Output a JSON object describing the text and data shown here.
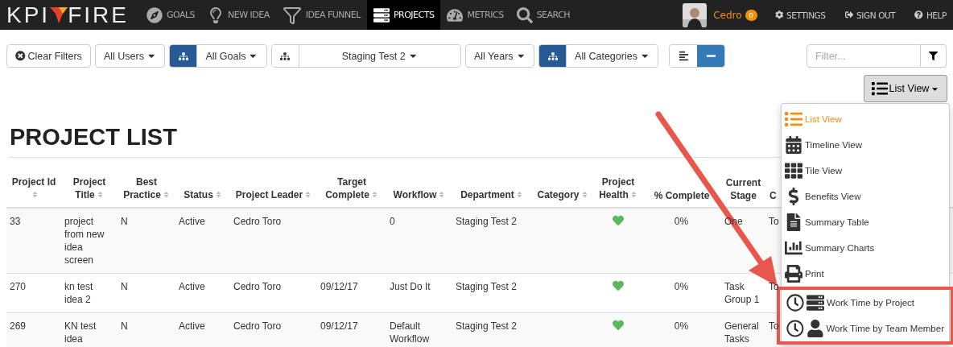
{
  "navbar": {
    "logo": {
      "left": "KPI",
      "right": "FIRE"
    },
    "items": [
      {
        "label": "GOALS",
        "selected": false
      },
      {
        "label": "NEW IDEA",
        "selected": false
      },
      {
        "label": "IDEA FUNNEL",
        "selected": false
      },
      {
        "label": "PROJECTS",
        "selected": true
      },
      {
        "label": "METRICS",
        "selected": false
      },
      {
        "label": "SEARCH",
        "selected": false
      }
    ],
    "user": {
      "name": "Cedro",
      "badge": "0"
    },
    "links": [
      {
        "label": "SETTINGS"
      },
      {
        "label": "SIGN OUT"
      },
      {
        "label": "HELP"
      }
    ]
  },
  "filters": [
    {
      "kind": "clear",
      "label": "Clear Filters"
    },
    {
      "kind": "dropdown",
      "label": "All Users"
    },
    {
      "kind": "tree-dropdown",
      "label": "All Goals",
      "active": true
    },
    {
      "kind": "tree-dropdown",
      "label": "Staging Test 2",
      "active": false
    },
    {
      "kind": "dropdown",
      "label": "All Years"
    },
    {
      "kind": "tree-dropdown",
      "label": "All Categories",
      "active": true
    },
    {
      "kind": "toggle",
      "options": [
        {
          "selected": false
        },
        {
          "selected": true
        }
      ]
    }
  ],
  "filter_field": {
    "placeholder": "Filter..."
  },
  "view_button": {
    "label": "List View"
  },
  "view_menu": [
    {
      "label": "List View",
      "selected": true,
      "highlighted": false
    },
    {
      "label": "Timeline View",
      "selected": false,
      "highlighted": false
    },
    {
      "label": "Tile View",
      "selected": false,
      "highlighted": false
    },
    {
      "label": "Benefits View",
      "selected": false,
      "highlighted": false
    },
    {
      "label": "Summary Table",
      "selected": false,
      "highlighted": false
    },
    {
      "label": "Summary Charts",
      "selected": false,
      "highlighted": false
    },
    {
      "label": "Print",
      "selected": false,
      "highlighted": false
    },
    {
      "label": "Work Time by Project",
      "selected": false,
      "highlighted": true
    },
    {
      "label": "Work Time by Team Member",
      "selected": false,
      "highlighted": true
    }
  ],
  "annotation": {
    "arrow": true
  },
  "page_title": "PROJECT LIST",
  "table": {
    "columns": [
      {
        "label": "Project Id",
        "sortable": true
      },
      {
        "label": "Project Title",
        "sortable": true
      },
      {
        "label": "Best Practice",
        "sortable": true
      },
      {
        "label": "Status",
        "sortable": true
      },
      {
        "label": "Project Leader",
        "sortable": true
      },
      {
        "label": "Target Complete",
        "sortable": true
      },
      {
        "label": "Workflow",
        "sortable": true
      },
      {
        "label": "Department",
        "sortable": true
      },
      {
        "label": "Category",
        "sortable": true
      },
      {
        "label": "Project Health",
        "sortable": true
      },
      {
        "label": "% Complete",
        "sortable": false
      },
      {
        "label": "Current Stage",
        "sortable": false
      },
      {
        "label": "C",
        "sortable": false
      }
    ],
    "rows": [
      {
        "cells": [
          "33",
          "project from new idea screen",
          "N",
          "Active",
          "Cedro Toro",
          "",
          "0",
          "Staging Test 2",
          "",
          "",
          "0%",
          "One",
          "To"
        ],
        "healthy": true
      },
      {
        "cells": [
          "270",
          "kn test idea 2",
          "N",
          "Active",
          "Cedro Toro",
          "09/12/17",
          "Just Do It",
          "Staging Test 2",
          "",
          "",
          "0%",
          "Task Group 1",
          "To"
        ],
        "healthy": true
      },
      {
        "cells": [
          "269",
          "KN test idea",
          "N",
          "Active",
          "Cedro Toro",
          "09/12/17",
          "Default Workflow",
          "Staging Test 2",
          "",
          "",
          "0%",
          "General Tasks",
          "To"
        ],
        "healthy": true
      }
    ]
  }
}
